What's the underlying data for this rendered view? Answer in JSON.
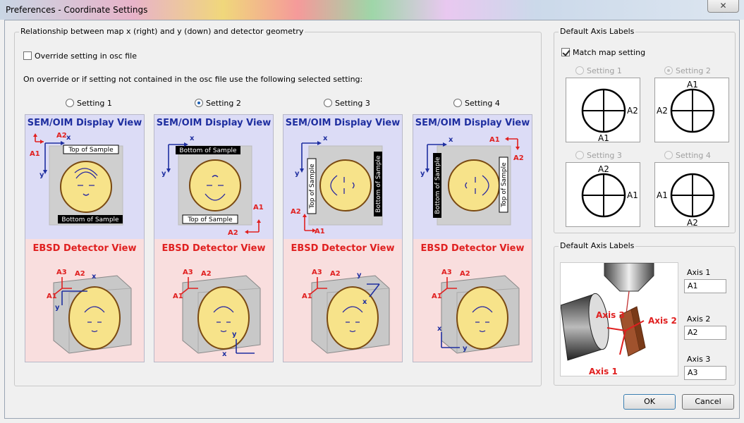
{
  "window": {
    "title": "Preferences - Coordinate Settings",
    "close": "✕"
  },
  "relationship": {
    "legend": "Relationship between map x (right) and y (down) and detector geometry",
    "override_label": "Override setting in osc file",
    "override_checked": false,
    "instruction": "On override or if setting not contained in the osc file use the following selected setting:",
    "settings": [
      {
        "label": "Setting 1",
        "selected": false
      },
      {
        "label": "Setting 2",
        "selected": true
      },
      {
        "label": "Setting 3",
        "selected": false
      },
      {
        "label": "Setting 4",
        "selected": false
      }
    ],
    "display_heading": "SEM/OIM Display View",
    "detector_heading": "EBSD Detector View",
    "top_of_sample": "Top of Sample",
    "bottom_of_sample": "Bottom of Sample",
    "x": "x",
    "y": "y",
    "a1": "A1",
    "a2": "A2",
    "a3": "A3"
  },
  "axis_labels_top": {
    "legend": "Default Axis Labels",
    "match_label": "Match map setting",
    "match_checked": true,
    "settings": [
      {
        "label": "Setting 1",
        "selected": false,
        "top": "",
        "right": "A2",
        "bottom": "A1",
        "left": ""
      },
      {
        "label": "Setting 2",
        "selected": true,
        "top": "A1",
        "right": "",
        "bottom": "",
        "left": "A2"
      },
      {
        "label": "Setting 3",
        "selected": false,
        "top": "A2",
        "right": "A1",
        "bottom": "",
        "left": ""
      },
      {
        "label": "Setting 4",
        "selected": false,
        "top": "",
        "right": "",
        "bottom": "A2",
        "left": "A1"
      }
    ]
  },
  "axis_labels_bottom": {
    "legend": "Default Axis Labels",
    "axis1_label": "Axis 1",
    "axis1_value": "A1",
    "axis2_label": "Axis 2",
    "axis2_value": "A2",
    "axis3_label": "Axis 3",
    "axis3_value": "A3",
    "diagram": {
      "axis1": "Axis 1",
      "axis2": "Axis 2",
      "axis3": "Axis 3"
    }
  },
  "buttons": {
    "ok": "OK",
    "cancel": "Cancel"
  },
  "colors": {
    "blue": "#1f2fa0",
    "red": "#e02020",
    "face": "#f7e38a",
    "face_outline": "#7a4a12"
  }
}
